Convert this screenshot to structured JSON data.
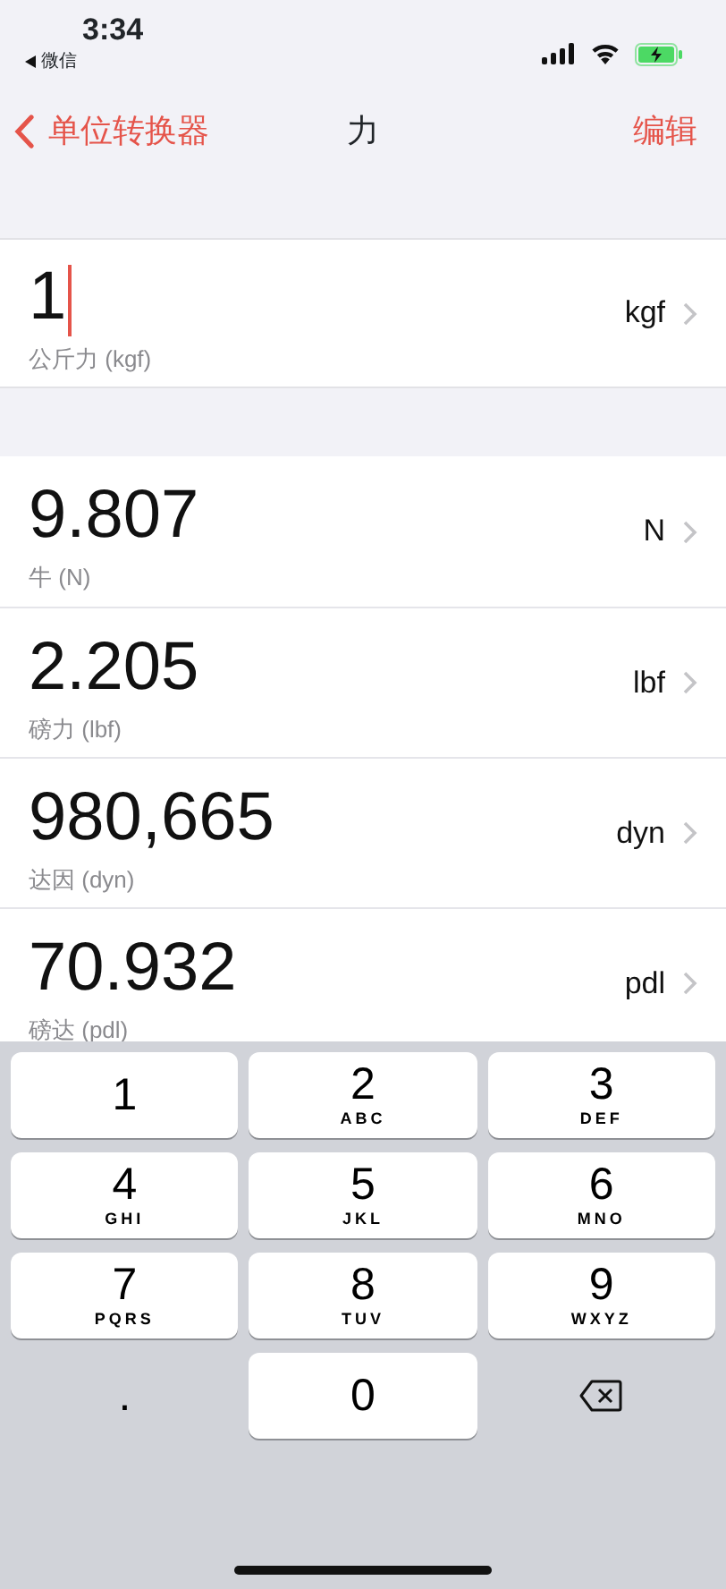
{
  "status_bar": {
    "time": "3:34",
    "back_app": "微信",
    "battery_charging": true
  },
  "nav": {
    "back_label": "单位转换器",
    "title": "力",
    "action": "编辑"
  },
  "input": {
    "value": "1",
    "focused": true,
    "unit": "kgf",
    "label": "公斤力 (kgf)"
  },
  "results": [
    {
      "value": "9.807",
      "unit": "N",
      "label": "牛 (N)"
    },
    {
      "value": "2.205",
      "unit": "lbf",
      "label": "磅力 (lbf)"
    },
    {
      "value": "980,665",
      "unit": "dyn",
      "label": "达因 (dyn)"
    },
    {
      "value": "70.932",
      "unit": "pdl",
      "label": "磅达 (pdl)"
    }
  ],
  "keypad": [
    {
      "kind": "digit",
      "digit": "1"
    },
    {
      "kind": "digit",
      "digit": "2",
      "letters": "ABC"
    },
    {
      "kind": "digit",
      "digit": "3",
      "letters": "DEF"
    },
    {
      "kind": "digit",
      "digit": "4",
      "letters": "GHI"
    },
    {
      "kind": "digit",
      "digit": "5",
      "letters": "JKL"
    },
    {
      "kind": "digit",
      "digit": "6",
      "letters": "MNO"
    },
    {
      "kind": "digit",
      "digit": "7",
      "letters": "PQRS"
    },
    {
      "kind": "digit",
      "digit": "8",
      "letters": "TUV"
    },
    {
      "kind": "digit",
      "digit": "9",
      "letters": "WXYZ"
    },
    {
      "kind": "dot",
      "digit": "."
    },
    {
      "kind": "digit",
      "digit": "0"
    },
    {
      "kind": "delete"
    }
  ]
}
